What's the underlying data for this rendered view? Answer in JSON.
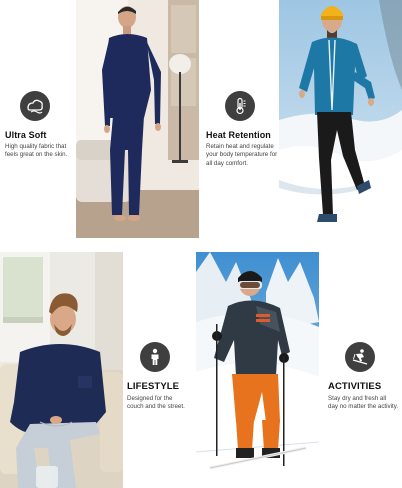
{
  "features": [
    {
      "icon": "ultra-soft-icon",
      "title": "Ultra Soft",
      "desc_line1": "High quality fabric that",
      "desc_line2": "feels great on the skin."
    },
    {
      "icon": "thermometer-icon",
      "title": "Heat Retention",
      "desc_line1": "Retain heat and regulate",
      "desc_line2": "your body temperature for",
      "desc_line3": "all day comfort."
    },
    {
      "icon": "person-icon",
      "title": "LIFESTYLE",
      "desc_line1": "Designed for the",
      "desc_line2": "couch and the street."
    },
    {
      "icon": "skier-icon",
      "title": "ACTIVITIES",
      "desc_line1": "Stay dry and fresh all",
      "desc_line2": "day no matter the activity."
    }
  ],
  "colors": {
    "icon_bg": "#3f3f3f",
    "garment_navy": "#1f2a5c",
    "ski_pants_orange": "#e8731f",
    "jacket_teal": "#1e78a6"
  }
}
